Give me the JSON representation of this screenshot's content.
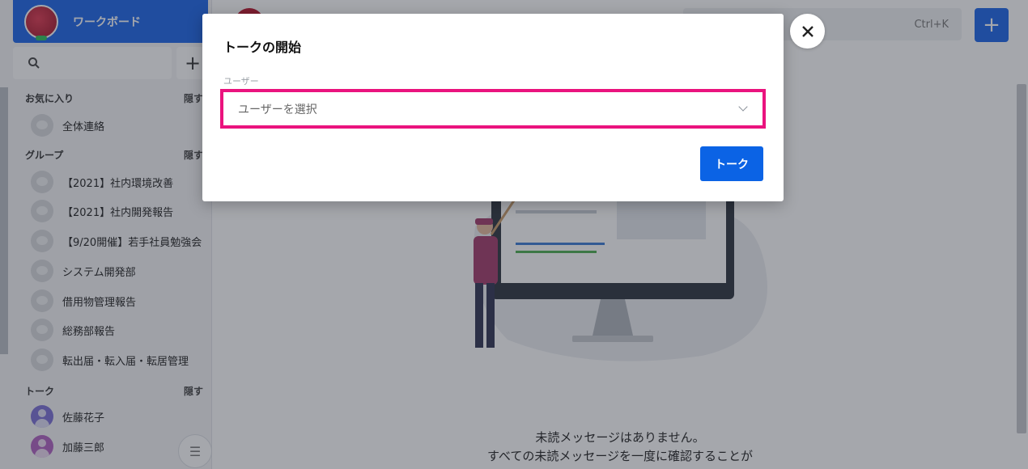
{
  "sidebar": {
    "workspace_name": "ワークボード",
    "favorites": {
      "title": "お気に入り",
      "hide": "隠す",
      "items": [
        {
          "label": "全体連絡"
        }
      ]
    },
    "groups": {
      "title": "グループ",
      "hide": "隠す",
      "items": [
        {
          "label": "【2021】社内環境改善"
        },
        {
          "label": "【2021】社内開発報告"
        },
        {
          "label": "【9/20開催】若手社員勉強会"
        },
        {
          "label": "システム開発部"
        },
        {
          "label": "借用物管理報告"
        },
        {
          "label": "総務部報告"
        },
        {
          "label": "転出届・転入届・転居管理"
        }
      ]
    },
    "talks": {
      "title": "トーク",
      "hide": "隠す",
      "items": [
        {
          "label": "佐藤花子",
          "color": "#7a6fd6"
        },
        {
          "label": "加藤三郎",
          "color": "#b061c2"
        }
      ]
    }
  },
  "header": {
    "search_shortcut": "Ctrl+K"
  },
  "main": {
    "empty_line1": "未読メッセージはありません。",
    "empty_line2": "すべての未読メッセージを一度に確認することが"
  },
  "modal": {
    "title": "トークの開始",
    "user_label": "ユーザー",
    "user_placeholder": "ユーザーを選択",
    "talk_button": "トーク",
    "close_icon": "close-icon"
  },
  "colors": {
    "brand": "#1a64e8",
    "highlight": "#ea137e"
  }
}
